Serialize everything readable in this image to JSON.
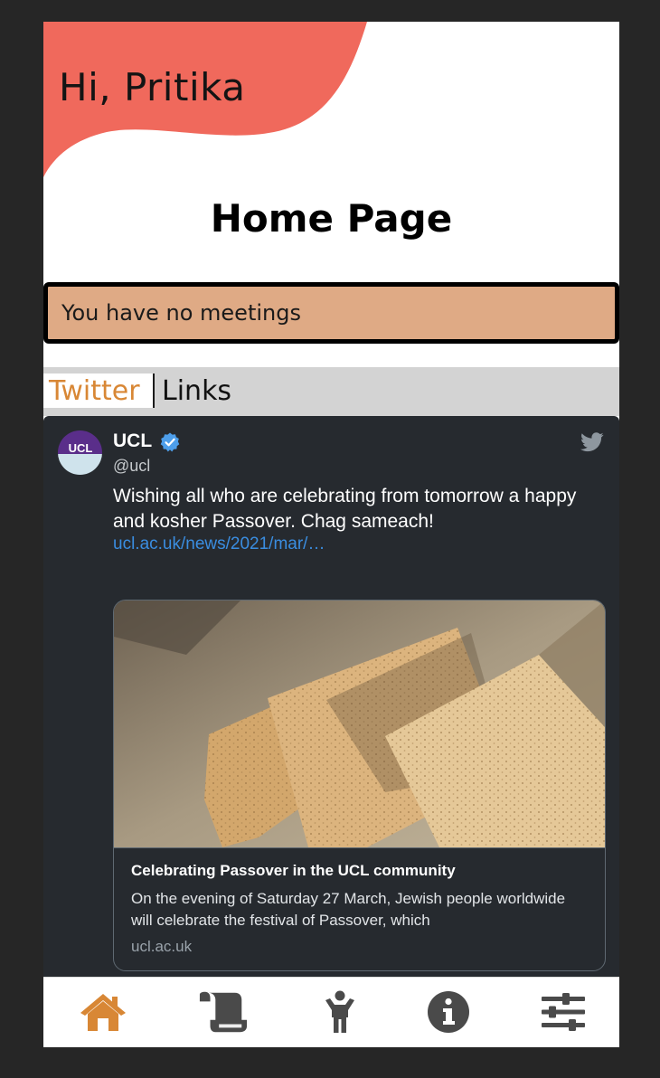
{
  "greeting": "Hi, Pritika",
  "page_title": "Home Page",
  "meetings_status": "You have no meetings",
  "tabs": [
    {
      "label": "Twitter",
      "active": true
    },
    {
      "label": "Links",
      "active": false
    }
  ],
  "tweet": {
    "account_name": "UCL",
    "handle": "@ucl",
    "avatar_text": "UCL",
    "text": "Wishing all who are celebrating from tomorrow a happy and kosher Passover. Chag sameach!",
    "link": "ucl.ac.uk/news/2021/mar/…",
    "card": {
      "title": "Celebrating Passover in the UCL community",
      "description": "On the evening of Saturday 27 March, Jewish people worldwide will celebrate the festival of Passover, which",
      "domain": "ucl.ac.uk"
    }
  },
  "bottom_nav": [
    {
      "icon": "home-icon",
      "active": true
    },
    {
      "icon": "scroll-icon",
      "active": false
    },
    {
      "icon": "person-icon",
      "active": false
    },
    {
      "icon": "info-icon",
      "active": false
    },
    {
      "icon": "sliders-icon",
      "active": false
    }
  ],
  "colors": {
    "accent": "#d88735",
    "header_blob": "#f0695c",
    "meetings_bg": "#dfaa85",
    "tweet_bg": "#262a2f",
    "link": "#3a8de0",
    "icon_gray": "#4a4a4a"
  }
}
